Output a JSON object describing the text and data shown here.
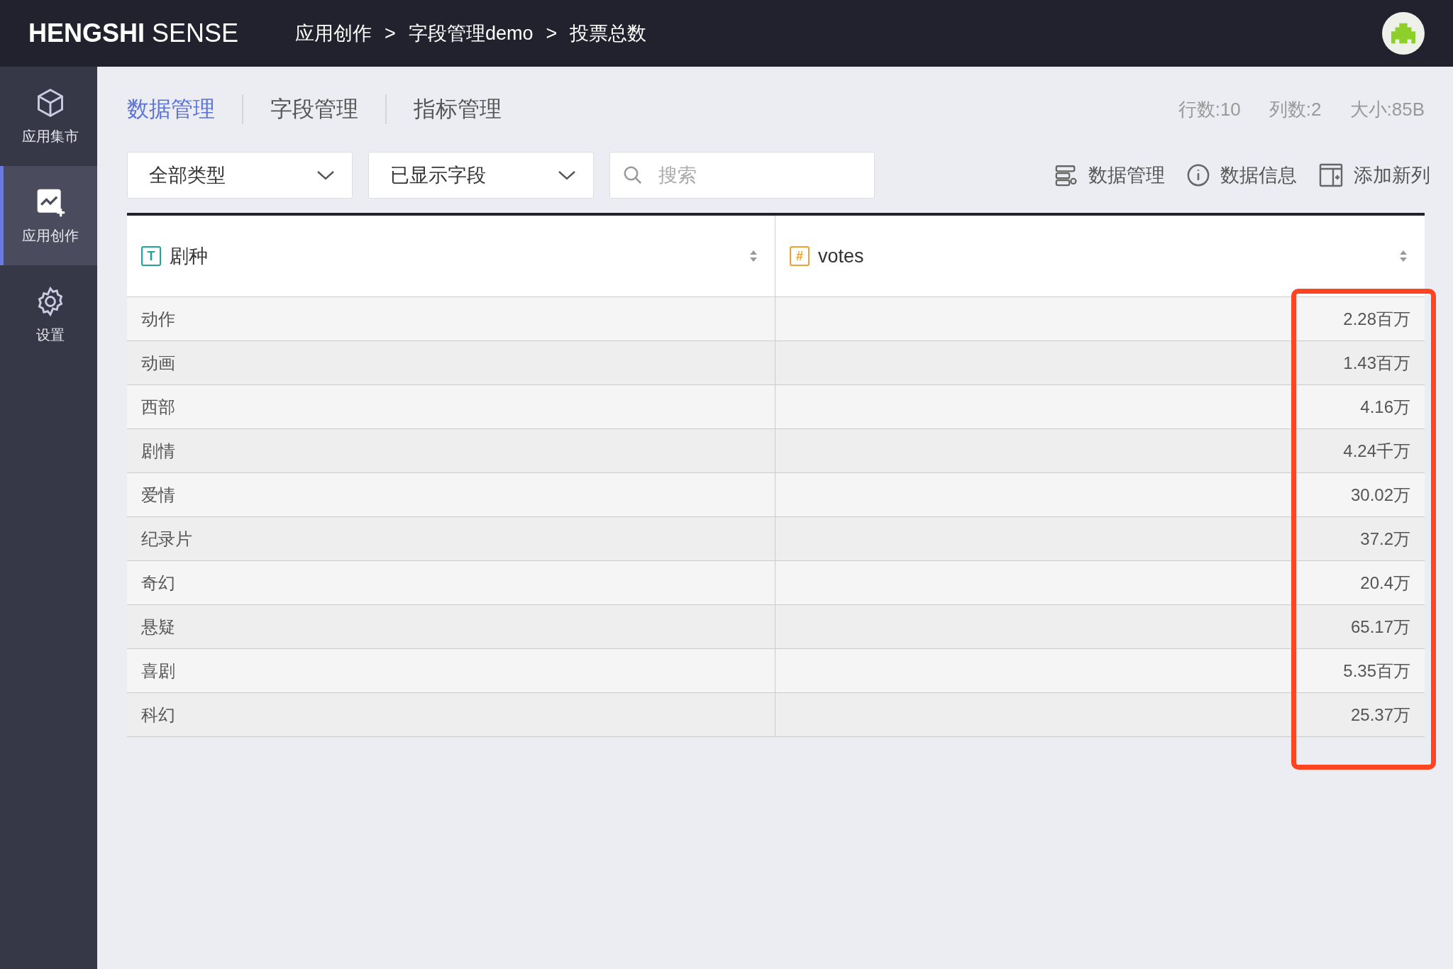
{
  "header": {
    "logo_bold": "HENGSHI",
    "logo_light": "SENSE",
    "breadcrumb": [
      "应用创作",
      "字段管理demo",
      "投票总数"
    ],
    "breadcrumb_separators": [
      ">",
      ">"
    ]
  },
  "sidebar": {
    "items": [
      {
        "label": "应用集市",
        "kind": "market",
        "selected": false
      },
      {
        "label": "应用创作",
        "kind": "create",
        "selected": true
      },
      {
        "label": "设置",
        "kind": "settings",
        "selected": false
      }
    ]
  },
  "tabs": [
    {
      "label": "数据管理",
      "selected": true
    },
    {
      "label": "字段管理",
      "selected": false
    },
    {
      "label": "指标管理",
      "selected": false
    }
  ],
  "stats": [
    "行数:10",
    "列数:2",
    "大小:85B"
  ],
  "filters": [
    {
      "value": "全部类型"
    },
    {
      "value": "已显示字段"
    }
  ],
  "search": {
    "placeholder": "搜索"
  },
  "actions": [
    {
      "label": "数据管理",
      "kind": "data"
    },
    {
      "label": "数据信息",
      "kind": "info"
    },
    {
      "label": "添加新列",
      "kind": "add-column"
    }
  ],
  "table": {
    "columns": [
      {
        "label": "剧种",
        "type_label": "T",
        "kind": "text",
        "highlighted": false
      },
      {
        "label": "votes",
        "type_label": "#",
        "kind": "number",
        "highlighted": true
      }
    ],
    "rows": [
      [
        "动作",
        "2.28百万"
      ],
      [
        "动画",
        "1.43百万"
      ],
      [
        "西部",
        "4.16万"
      ],
      [
        "剧情",
        "4.24千万"
      ],
      [
        "爱情",
        "30.02万"
      ],
      [
        "纪录片",
        "37.2万"
      ],
      [
        "奇幻",
        "20.4万"
      ],
      [
        "悬疑",
        "65.17万"
      ],
      [
        "喜剧",
        "5.35百万"
      ],
      [
        "科幻",
        "25.37万"
      ]
    ]
  }
}
